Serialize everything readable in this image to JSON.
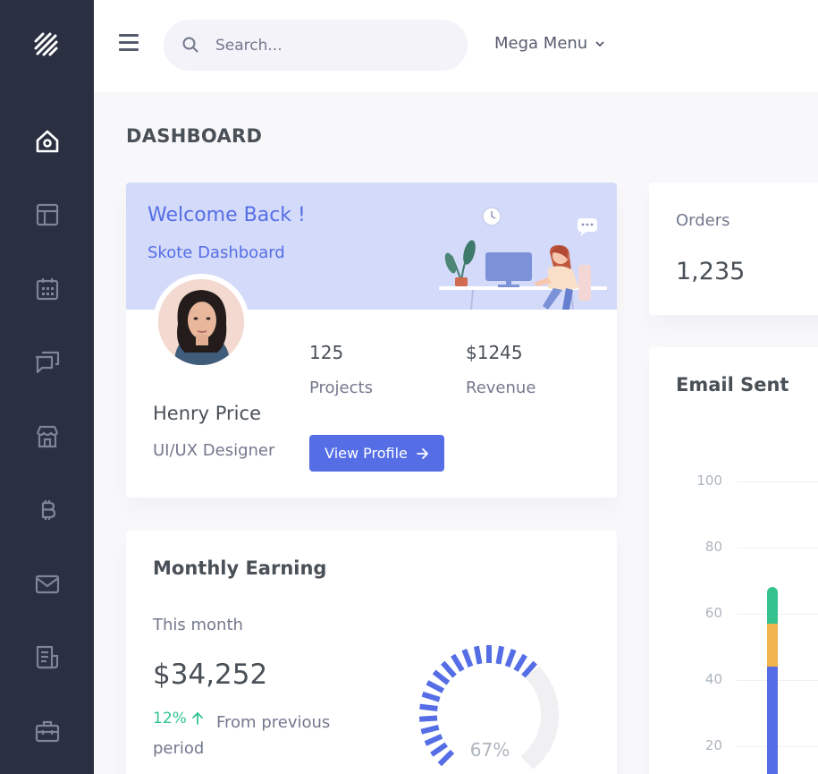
{
  "search": {
    "placeholder": "Search..."
  },
  "topbar": {
    "mega_menu_label": "Mega Menu"
  },
  "page": {
    "title": "DASHBOARD"
  },
  "sidebar": {
    "items": [
      {
        "icon": "home-icon"
      },
      {
        "icon": "layout-icon"
      },
      {
        "icon": "calendar-icon"
      },
      {
        "icon": "chat-icon"
      },
      {
        "icon": "store-icon"
      },
      {
        "icon": "bitcoin-icon"
      },
      {
        "icon": "mail-icon"
      },
      {
        "icon": "invoice-icon"
      },
      {
        "icon": "briefcase-icon"
      }
    ]
  },
  "welcome": {
    "title": "Welcome Back !",
    "subtitle": "Skote Dashboard",
    "name": "Henry Price",
    "role": "UI/UX Designer",
    "stats": [
      {
        "value": "125",
        "label": "Projects"
      },
      {
        "value": "$1245",
        "label": "Revenue"
      }
    ],
    "button_label": "View Profile"
  },
  "monthly": {
    "title": "Monthly Earning",
    "period_label": "This month",
    "amount": "$34,252",
    "change_pct": "12%",
    "change_text_1": "From previous",
    "change_text_2": "period",
    "gauge_value": 67,
    "gauge_label": "67%"
  },
  "orders": {
    "label": "Orders",
    "value": "1,235"
  },
  "email_sent": {
    "title": "Email Sent"
  },
  "chart_data": {
    "type": "bar",
    "title": "Email Sent",
    "yticks": [
      "100",
      "80",
      "60",
      "40",
      "20"
    ],
    "ylim": [
      0,
      100
    ],
    "stacked": true,
    "series": [
      {
        "values": [
          44
        ],
        "color": "#556ee6"
      },
      {
        "values": [
          13
        ],
        "color": "#f1b44c"
      },
      {
        "values": [
          11
        ],
        "color": "#34c38f"
      }
    ]
  },
  "colors": {
    "primary": "#556ee6",
    "success": "#34c38f",
    "warning": "#f1b44c",
    "sidebar": "#2a3042"
  }
}
